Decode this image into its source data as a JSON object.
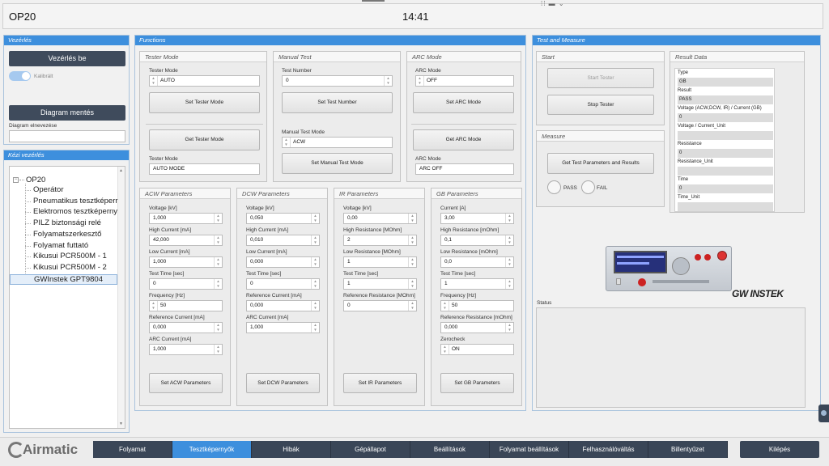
{
  "header": {
    "title": "OP20",
    "clock": "14:41"
  },
  "vezerles": {
    "title": "Vezérlés",
    "control_button": "Vezérlés be",
    "toggle_label": "Kalibrált",
    "diagram_save_button": "Diagram mentés",
    "diagram_name_label": "Diagram elnevezése",
    "diagram_name_value": ""
  },
  "kezi": {
    "title": "Kézi vezérlés",
    "root": "OP20",
    "items": [
      "Operátor",
      "Pneumatikus tesztképerr",
      "Elektromos tesztképerny",
      "PILZ biztonsági relé",
      "Folyamatszerkesztő",
      "Folyamat futtató",
      "Kikusui PCR500M - 1",
      "Kikusui PCR500M - 2",
      "GWInstek GPT9804"
    ],
    "selected_index": 8
  },
  "functions": {
    "title": "Functions",
    "tester_mode": {
      "title": "Tester Mode",
      "label": "Tester Mode",
      "value": "AUTO",
      "set_button": "Set Tester Mode",
      "get_button": "Get Tester Mode",
      "readback_label": "Tester Mode",
      "readback_value": "AUTO MODE"
    },
    "manual_test": {
      "title": "Manual Test",
      "number_label": "Test Number",
      "number_value": "0",
      "set_number_button": "Set Test Number",
      "mode_label": "Manual Test Mode",
      "mode_value": "ACW",
      "set_mode_button": "Set Manual Test Mode"
    },
    "arc_mode": {
      "title": "ARC Mode",
      "label": "ARC Mode",
      "value": "OFF",
      "set_button": "Set ARC Mode",
      "get_button": "Get ARC Mode",
      "readback_label": "ARC Mode",
      "readback_value": "ARC OFF"
    },
    "acw": {
      "title": "ACW Parameters",
      "params": [
        {
          "label": "Voltage [kV]",
          "value": "1,000"
        },
        {
          "label": "High Current [mA]",
          "value": "42,000"
        },
        {
          "label": "Low Current [mA]",
          "value": "1,000"
        },
        {
          "label": "Test Time [sec]",
          "value": "0"
        },
        {
          "label": "Frequency [Hz]",
          "value": "50"
        },
        {
          "label": "Reference Current [mA]",
          "value": "0,000"
        },
        {
          "label": "ARC Current [mA]",
          "value": "1,000"
        }
      ],
      "button": "Set ACW Parameters"
    },
    "dcw": {
      "title": "DCW Parameters",
      "params": [
        {
          "label": "Voltage [kV]",
          "value": "0,050"
        },
        {
          "label": "High Current [mA]",
          "value": "0,010"
        },
        {
          "label": "Low Current [mA]",
          "value": "0,000"
        },
        {
          "label": "Test Time [sec]",
          "value": "0"
        },
        {
          "label": "Reference Current [mA]",
          "value": "0,000"
        },
        {
          "label": "ARC Current [mA]",
          "value": "1,000"
        }
      ],
      "button": "Set DCW Parameters"
    },
    "ir": {
      "title": "IR Parameters",
      "params": [
        {
          "label": "Voltage [kV]",
          "value": "0,00"
        },
        {
          "label": "High Resistance [MOhm]",
          "value": "2"
        },
        {
          "label": "Low Resistance [MOhm]",
          "value": "1"
        },
        {
          "label": "Test Time [sec]",
          "value": "1"
        },
        {
          "label": "Reference Resistance [MOhm]",
          "value": "0"
        }
      ],
      "button": "Set IR Parameters"
    },
    "gb": {
      "title": "GB Parameters",
      "params": [
        {
          "label": "Current [A]",
          "value": "3,00"
        },
        {
          "label": "High Resistance [mOhm]",
          "value": "0,1"
        },
        {
          "label": "Low Resistance [mOhm]",
          "value": "0,0"
        },
        {
          "label": "Test Time [sec]",
          "value": "1"
        },
        {
          "label": "Frequency [Hz]",
          "value": "50"
        },
        {
          "label": "Reference Resistance [mOhm]",
          "value": "0,000"
        },
        {
          "label": "Zerocheck",
          "value": "ON"
        }
      ],
      "button": "Set GB Parameters"
    }
  },
  "test_measure": {
    "title": "Test and Measure",
    "start": {
      "title": "Start",
      "start_button": "Start Tester",
      "stop_button": "Stop Tester"
    },
    "measure": {
      "title": "Measure",
      "get_button": "Get Test Parameters and Results",
      "pass_label": "PASS",
      "fail_label": "FAIL"
    },
    "result": {
      "title": "Result Data",
      "rows": [
        {
          "label": "Type",
          "value": "GB"
        },
        {
          "label": "Result",
          "value": "PASS"
        },
        {
          "label": "Voltage (ACW,DCW, IR) / Current (GB)",
          "value": "0"
        },
        {
          "label": "Voltage / Current_Unit",
          "value": ""
        },
        {
          "label": "Resistance",
          "value": "0"
        },
        {
          "label": "Resistance_Unit",
          "value": ""
        },
        {
          "label": "Time",
          "value": "0"
        },
        {
          "label": "Time_Unit",
          "value": ""
        }
      ]
    },
    "device": {
      "brand": "GW INSTEK"
    },
    "status": {
      "title": "Status",
      "value": ""
    }
  },
  "logo": "Airmatic",
  "nav": {
    "items": [
      "Folyamat",
      "Tesztképernyők",
      "Hibák",
      "Gépállapot",
      "Beállítások",
      "Folyamat beállítások",
      "Felhasználóváltás",
      "Billentyűzet"
    ],
    "active_index": 1,
    "exit": "Kilépés"
  },
  "colors": {
    "accent": "#3d8fdd",
    "dark": "#3a4657"
  }
}
